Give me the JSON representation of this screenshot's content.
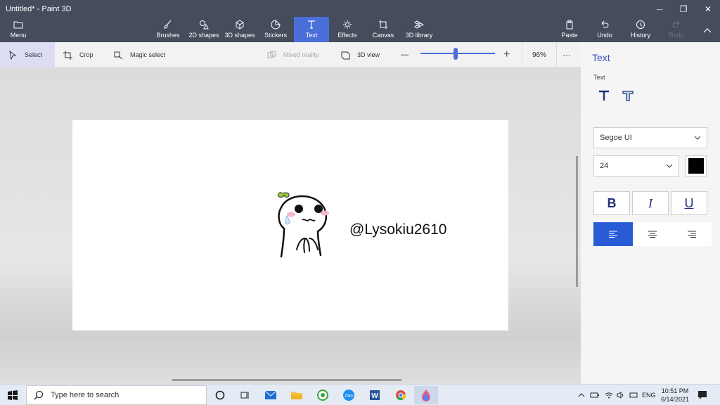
{
  "window": {
    "title": "Untitled* - Paint 3D",
    "menu_label": "Menu",
    "controls": {
      "minimize": "—",
      "restore": "❐",
      "close": "✕"
    }
  },
  "ribbon": {
    "tools": [
      {
        "label": "Brushes",
        "icon": "brush-icon"
      },
      {
        "label": "2D shapes",
        "icon": "2d-shapes-icon"
      },
      {
        "label": "3D shapes",
        "icon": "3d-shapes-icon"
      },
      {
        "label": "Stickers",
        "icon": "stickers-icon"
      },
      {
        "label": "Text",
        "icon": "text-icon",
        "active": true
      },
      {
        "label": "Effects",
        "icon": "effects-icon"
      },
      {
        "label": "Canvas",
        "icon": "canvas-icon"
      },
      {
        "label": "3D library",
        "icon": "3d-library-icon"
      }
    ],
    "paste_label": "Paste",
    "undo_label": "Undo",
    "history_label": "History",
    "redo_label": "Redo"
  },
  "toolbar": {
    "select_label": "Select",
    "crop_label": "Crop",
    "magic_select_label": "Magic select",
    "mixed_reality_label": "Mixed reality",
    "view_3d_label": "3D view",
    "zoom_minus": "—",
    "zoom_plus": "+",
    "zoom_level": "96%",
    "zoom_fraction": 0.5,
    "more": "···"
  },
  "canvas": {
    "text": "@Lysokiu2610",
    "sticker": "cartoon-ghost-sticker"
  },
  "panel": {
    "title": "Text",
    "subtitle": "Text",
    "font": "Segoe UI",
    "size": "24",
    "color": "#000000",
    "bold": "B",
    "italic": "I",
    "underline": "U",
    "alignment": "left"
  },
  "taskbar": {
    "search_placeholder": "Type here to search",
    "language": "ENG",
    "time": "10:51 PM",
    "date": "6/14/2021",
    "apps": [
      "task-view-icon",
      "mail-icon",
      "file-explorer-icon",
      "green-app-icon",
      "zalo-icon",
      "word-icon",
      "chrome-icon",
      "paint-3d-icon"
    ]
  },
  "colors": {
    "ribbon": "#454c5b",
    "accent": "#4a6fd8",
    "panel_title": "#3a4fc4"
  }
}
